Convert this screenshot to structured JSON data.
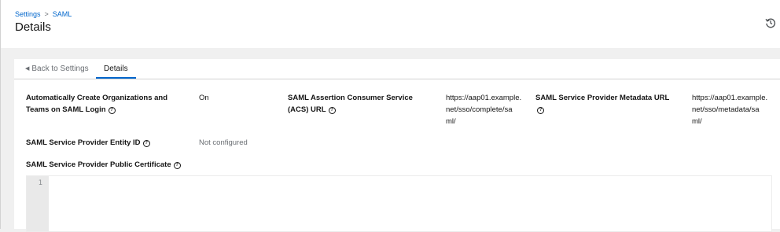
{
  "breadcrumb": {
    "parent": "Settings",
    "separator": ">",
    "current": "SAML"
  },
  "page": {
    "title": "Details"
  },
  "header": {
    "history_icon": "history-icon"
  },
  "tabs": {
    "back_label": "Back to Settings",
    "back_icon": "caret-left-icon",
    "active_label": "Details"
  },
  "fields": {
    "auto_create": {
      "label_line1": "Automatically Create Organizations and",
      "label_line2": "Teams on SAML Login",
      "value": "On"
    },
    "acs_url": {
      "label_line1": "SAML Assertion Consumer Service",
      "label_line2": "(ACS) URL",
      "value_line1": "https://aap01.example.",
      "value_line2": "net/sso/complete/sa",
      "value_line3": "ml/"
    },
    "metadata_url": {
      "label": "SAML Service Provider Metadata URL",
      "value_line1": "https://aap01.example.",
      "value_line2": "net/sso/metadata/sa",
      "value_line3": "ml/"
    },
    "entity_id": {
      "label": "SAML Service Provider Entity ID",
      "value": "Not configured"
    },
    "public_cert": {
      "label": "SAML Service Provider Public Certificate"
    }
  },
  "editor": {
    "line_number": "1"
  },
  "help_icon": "?"
}
